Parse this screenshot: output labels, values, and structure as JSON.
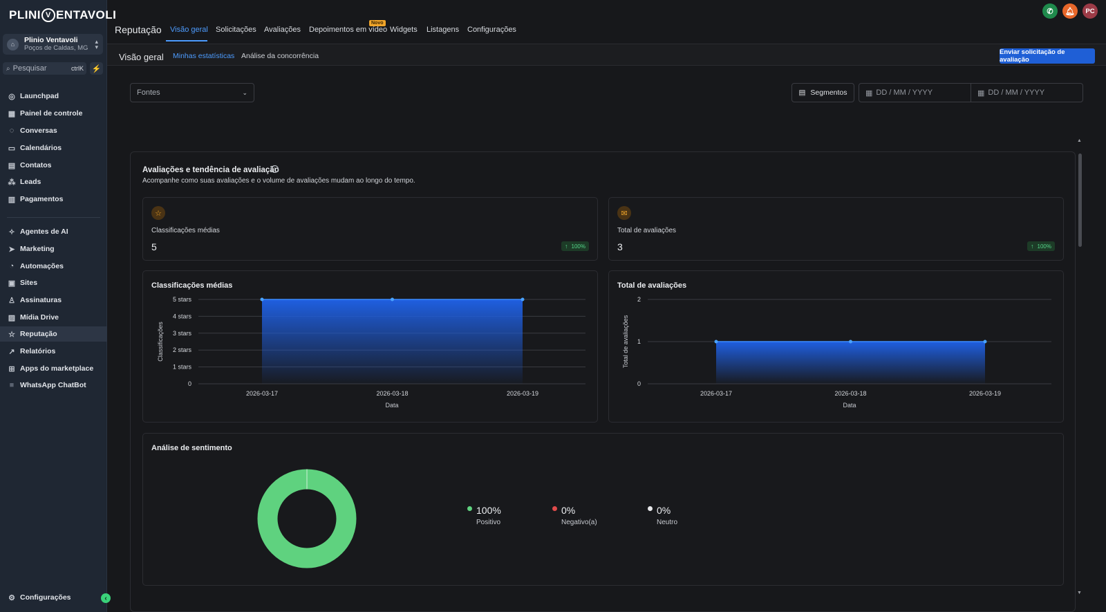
{
  "brand": {
    "logo_left": "PLINI",
    "logo_mark": "V",
    "logo_right": "ENTAVOLI"
  },
  "account": {
    "name": "Plinio Ventavoli",
    "location": "Poços de Caldas, MG",
    "avatar_icon": "building-icon"
  },
  "search": {
    "placeholder": "Pesquisar",
    "shortcut": "ctrlK"
  },
  "sidebar": {
    "items": [
      {
        "label": "Launchpad",
        "icon": "rocket-icon"
      },
      {
        "label": "Painel de controle",
        "icon": "grid-icon"
      },
      {
        "label": "Conversas",
        "icon": "chat-icon"
      },
      {
        "label": "Calendários",
        "icon": "calendar-icon"
      },
      {
        "label": "Contatos",
        "icon": "contacts-icon"
      },
      {
        "label": "Leads",
        "icon": "leads-icon"
      },
      {
        "label": "Pagamentos",
        "icon": "payment-icon"
      },
      {
        "label": "Agentes de AI",
        "icon": "sparkle-icon"
      },
      {
        "label": "Marketing",
        "icon": "send-icon"
      },
      {
        "label": "Automações",
        "icon": "automation-icon"
      },
      {
        "label": "Sites",
        "icon": "sites-icon"
      },
      {
        "label": "Assinaturas",
        "icon": "badge-icon"
      },
      {
        "label": "Mídia Drive",
        "icon": "image-icon"
      },
      {
        "label": "Reputação",
        "icon": "star-icon"
      },
      {
        "label": "Relatórios",
        "icon": "trend-icon"
      },
      {
        "label": "Apps do marketplace",
        "icon": "apps-icon"
      },
      {
        "label": "WhatsApp ChatBot",
        "icon": "whatsapp-icon"
      }
    ],
    "active": "Reputação",
    "settings_label": "Configurações"
  },
  "header": {
    "title": "Reputação",
    "tabs": [
      "Visão geral",
      "Solicitações",
      "Avaliações",
      "Depoimentos em vídeo",
      "Widgets",
      "Listagens",
      "Configurações"
    ],
    "new_badge": "Novo",
    "user_initials": "PC",
    "colors": {
      "phone": "#1f8a4c",
      "bell": "#e8672a",
      "avatar": "#9c3b47"
    }
  },
  "subheader": {
    "title": "Visão geral",
    "tabs": [
      "Minhas estatísticas",
      "Análise da concorrência"
    ],
    "cta": "Enviar solicitação de avaliação"
  },
  "filters": {
    "source_placeholder": "Fontes",
    "segments_label": "Segmentos",
    "date_start_placeholder": "DD / MM / YYYY",
    "date_end_placeholder": "DD / MM / YYYY"
  },
  "section": {
    "title": "Avaliações e tendência de avaliação",
    "subtitle": "Acompanhe como suas avaliações e o volume de avaliações mudam ao longo do tempo."
  },
  "kpis": [
    {
      "label": "Classificações médias",
      "value": "5",
      "change": "100%",
      "icon": "star-icon"
    },
    {
      "label": "Total de avaliações",
      "value": "3",
      "change": "100%",
      "icon": "review-icon"
    }
  ],
  "chart_data": [
    {
      "type": "area",
      "title": "Classificações médias",
      "xlabel": "Data",
      "ylabel": "Classificações",
      "x": [
        "2026-03-17",
        "2026-03-18",
        "2026-03-19"
      ],
      "values": [
        5,
        5,
        5
      ],
      "ylim": [
        0,
        5
      ],
      "yticks": [
        "0",
        "1 stars",
        "2 stars",
        "3 stars",
        "4 stars",
        "5 stars"
      ],
      "color": "#1f5fe0"
    },
    {
      "type": "area",
      "title": "Total de avaliações",
      "xlabel": "Data",
      "ylabel": "Total de avaliações",
      "x": [
        "2026-03-17",
        "2026-03-18",
        "2026-03-19"
      ],
      "values": [
        1,
        1,
        1
      ],
      "ylim": [
        0,
        2
      ],
      "yticks": [
        "0",
        "1",
        "2"
      ],
      "color": "#1f5fe0"
    },
    {
      "type": "pie",
      "title": "Análise de sentimento",
      "categories": [
        "Positivo",
        "Negativo(a)",
        "Neutro"
      ],
      "values": [
        100,
        0,
        0
      ],
      "labels": [
        "100%",
        "0%",
        "0%"
      ],
      "colors": [
        "#5fd27f",
        "#e04b4b",
        "#e6e7ea"
      ]
    }
  ]
}
